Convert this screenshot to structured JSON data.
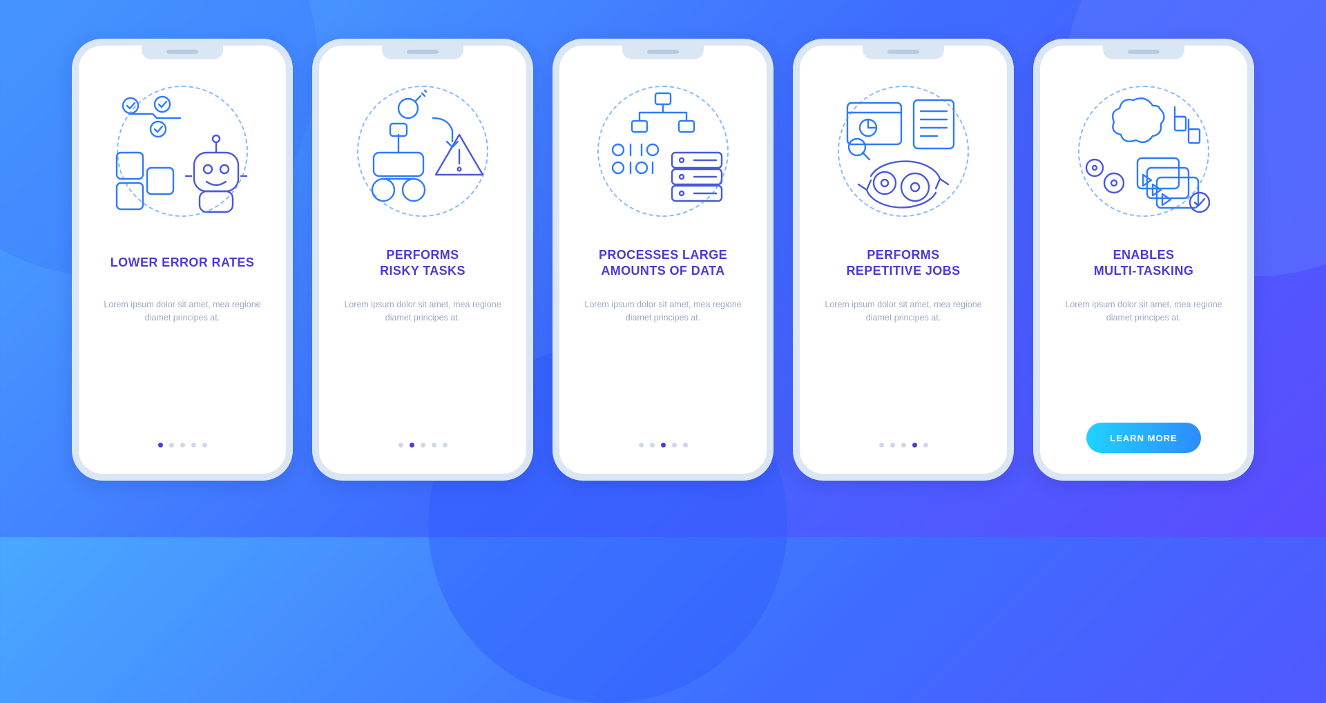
{
  "colors": {
    "title": "#4a3bd6",
    "body": "#9aa7c2",
    "dot_inactive": "#cfd8ea",
    "dot_active": "#4a3bd6",
    "cta_gradient_from": "#1fd3ff",
    "cta_gradient_to": "#2e8bff",
    "illustration_stroke": "#2e7bff"
  },
  "lorem": "Lorem ipsum dolor sit amet, mea regione diamet principes at.",
  "pagination_total": 5,
  "cta_label": "LEARN MORE",
  "screens": [
    {
      "icon": "robot-checklist-icon",
      "title": "LOWER ERROR RATES",
      "body": "Lorem ipsum dolor sit amet, mea regione diamet principes at.",
      "active_index": 0,
      "has_cta": false
    },
    {
      "icon": "rover-warning-icon",
      "title": "PERFORMS\nRISKY TASKS",
      "body": "Lorem ipsum dolor sit amet, mea regione diamet principes at.",
      "active_index": 1,
      "has_cta": false
    },
    {
      "icon": "binary-database-icon",
      "title": "PROCESSES LARGE\nAMOUNTS OF DATA",
      "body": "Lorem ipsum dolor sit amet, mea regione diamet principes at.",
      "active_index": 2,
      "has_cta": false
    },
    {
      "icon": "gears-reports-icon",
      "title": "PERFORMS\nREPETITIVE JOBS",
      "body": "Lorem ipsum dolor sit amet, mea regione diamet principes at.",
      "active_index": 3,
      "has_cta": false
    },
    {
      "icon": "brain-windows-icon",
      "title": "ENABLES\nMULTI-TASKING",
      "body": "Lorem ipsum dolor sit amet, mea regione diamet principes at.",
      "active_index": 4,
      "has_cta": true
    }
  ]
}
